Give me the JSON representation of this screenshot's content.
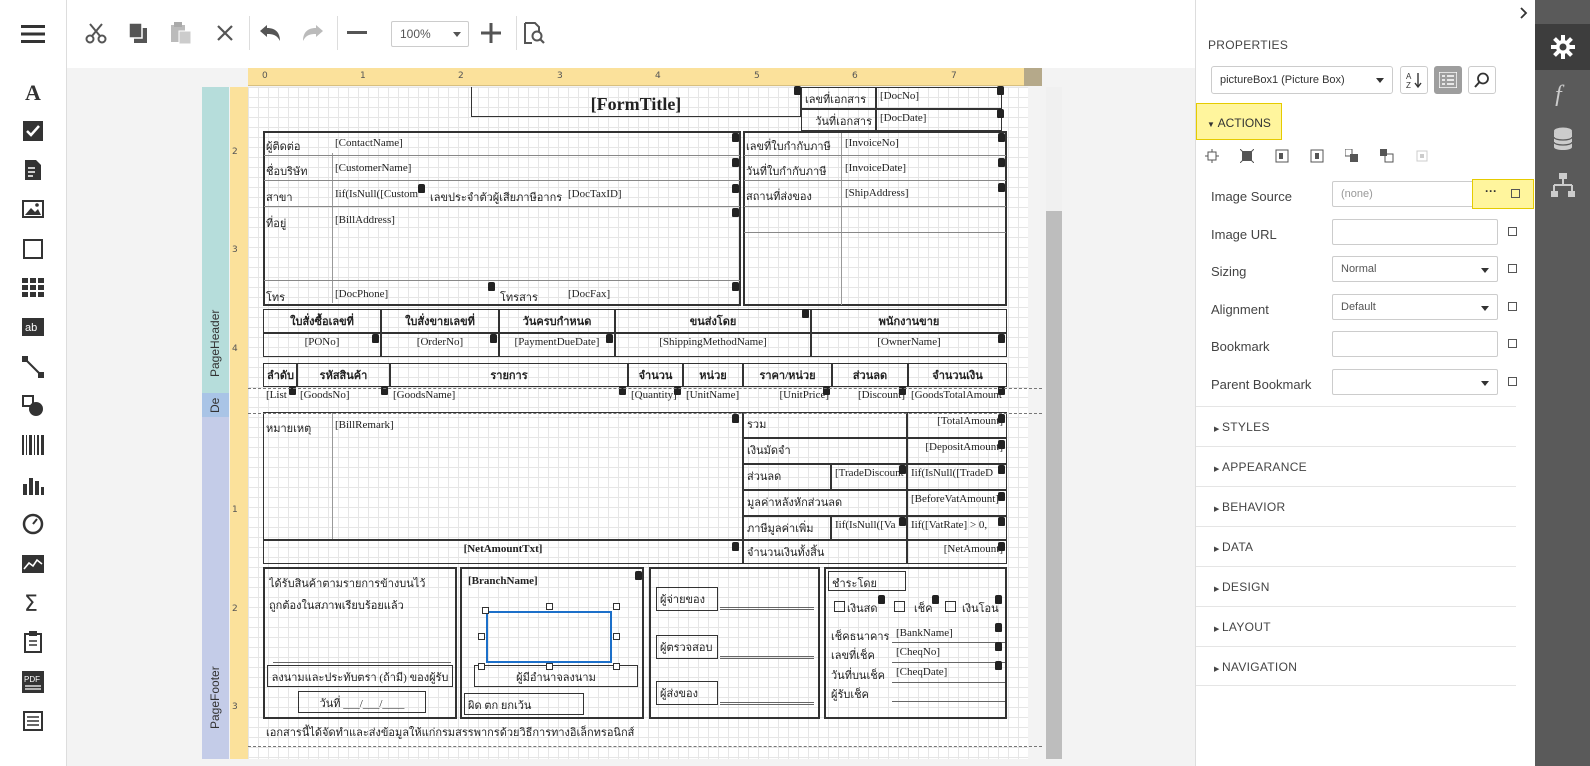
{
  "toolbar": {
    "zoom_value": "100%"
  },
  "ruler": {
    "h_ticks": [
      "0",
      "1",
      "2",
      "3",
      "4",
      "5",
      "6",
      "7"
    ],
    "v_ticks_header": [
      "2",
      "3",
      "4"
    ],
    "v_ticks_footer": [
      "1",
      "2",
      "3"
    ]
  },
  "bands": {
    "page_header": "PageHeader",
    "detail": "De",
    "page_footer": "PageFooter"
  },
  "report": {
    "form_title": "[FormTitle]",
    "doc_no_label": "เลขที่เอกสาร",
    "doc_no": "[DocNo]",
    "doc_date_label": "วันที่เอกสาร",
    "doc_date": "[DocDate]",
    "contact_label": "ผู้ติดต่อ",
    "contact": "[ContactName]",
    "company_label": "ชื่อบริษัท",
    "customer": "[CustomerName]",
    "branch_label": "สาขา",
    "branch_expr": "Iif(IsNull([Custom",
    "taxid_label": "เลขประจำตัวผู้เสียภาษีอากร",
    "taxid": "[DocTaxID]",
    "address_label": "ที่อยู่",
    "address": "[BillAddress]",
    "phone_label": "โทร",
    "phone": "[DocPhone]",
    "fax_label": "โทรสาร",
    "fax": "[DocFax]",
    "invoice_no_label": "เลขที่ใบกำกับภาษี",
    "invoice_no": "[InvoiceNo]",
    "invoice_date_label": "วันที่ใบกำกับภาษี",
    "invoice_date": "[InvoiceDate]",
    "ship_label": "สถานที่ส่งของ",
    "ship": "[ShipAddress]",
    "order_headers": [
      "ใบสั่งซื้อเลขที่",
      "ใบสั่งขายเลขที่",
      "วันครบกำหนด",
      "ขนส่งโดย",
      "พนักงานขาย"
    ],
    "order_values": [
      "[PONo]",
      "[OrderNo]",
      "[PaymentDueDate]",
      "[ShippingMethodName]",
      "[OwnerName]"
    ],
    "item_headers": [
      "ลำดับ",
      "รหัสสินค้า",
      "รายการ",
      "จำนวน",
      "หน่วย",
      "ราคา/หน่วย",
      "ส่วนลด",
      "จำนวนเงิน"
    ],
    "item_values": [
      "[List",
      "[GoodsNo]",
      "[GoodsName]",
      "[Quantity]",
      "[UnitName]",
      "[UnitPrice]",
      "[Discount]",
      "[GoodsTotalAmount"
    ],
    "remark_label": "หมายเหตุ",
    "remark": "[BillRemark]",
    "net_amount_txt": "[NetAmountTxt]",
    "total_labels": [
      "รวม",
      "เงินมัดจำ",
      "ส่วนลด",
      "มูลค่าหลังหักส่วนลด",
      "ภาษีมูลค่าเพิ่ม",
      "จำนวนเงินทั้งสิ้น"
    ],
    "total_values": [
      "[TotalAmount]",
      "[DepositAmount]",
      "Iif(IsNull([TradeD",
      "[BeforeVatAmount]",
      "Iif([VatRate] > 0,",
      "[NetAmount]"
    ],
    "trade_discount": "[TradeDiscount",
    "vat_expr": "Iif(IsNull([Va",
    "received_text_1": "ได้รับสินค้าตามรายการข้างบนไว้",
    "received_text_2": "ถูกต้องในสภาพเรียบร้อยแล้ว",
    "sign_receiver": "ลงนามและประทับตรา (ถ้ามี) ของผู้รับ",
    "date_line": "วันที่ ___/___/____",
    "branch_name": "[BranchName]",
    "authorized": "ผู้มีอำนาจลงนาม",
    "stamp_text": "ผิด ตก ยกเว้น",
    "payer_label": "ผู้จ่ายของ",
    "checker_label": "ผู้ตรวจสอบ",
    "sender_label": "ผู้ส่งของ",
    "pay_by_label": "ชำระโดย",
    "cash_label": "เงินสด",
    "cheque_label": "เช็ค",
    "transfer_label": "เงินโอน",
    "bank_label": "เช็คธนาคาร",
    "bank": "[BankName]",
    "cheq_no_label": "เลขที่เช็ค",
    "cheq_no": "[CheqNo]",
    "cheq_date_label": "วันที่บนเช็ค",
    "cheq_date": "[CheqDate]",
    "cheq_receiver_label": "ผู้รับเช็ค",
    "footer_note": "เอกสารนี้ได้จัดทำและส่งข้อมูลให้แก่กรมสรรพากรด้วยวิธีการทางอิเล็กทรอนิกส์"
  },
  "properties": {
    "title": "PROPERTIES",
    "selected_object": "pictureBox1 (Picture Box)",
    "actions_label": "ACTIONS",
    "rows": [
      {
        "label": "Image Source",
        "value": "(none)"
      },
      {
        "label": "Image URL",
        "value": ""
      },
      {
        "label": "Sizing",
        "value": "Normal"
      },
      {
        "label": "Alignment",
        "value": "Default"
      },
      {
        "label": "Bookmark",
        "value": ""
      },
      {
        "label": "Parent Bookmark",
        "value": ""
      }
    ],
    "browse_label": "···",
    "sections": [
      "STYLES",
      "APPEARANCE",
      "BEHAVIOR",
      "DATA",
      "DESIGN",
      "LAYOUT",
      "NAVIGATION"
    ]
  },
  "colors": {
    "highlight": "#fff59d",
    "selection": "#1b6fc9",
    "band_header": "#b6dddb",
    "band_footer": "#c4cce8",
    "ruler": "#fbe19b",
    "side_strip": "#5a5a5a"
  }
}
